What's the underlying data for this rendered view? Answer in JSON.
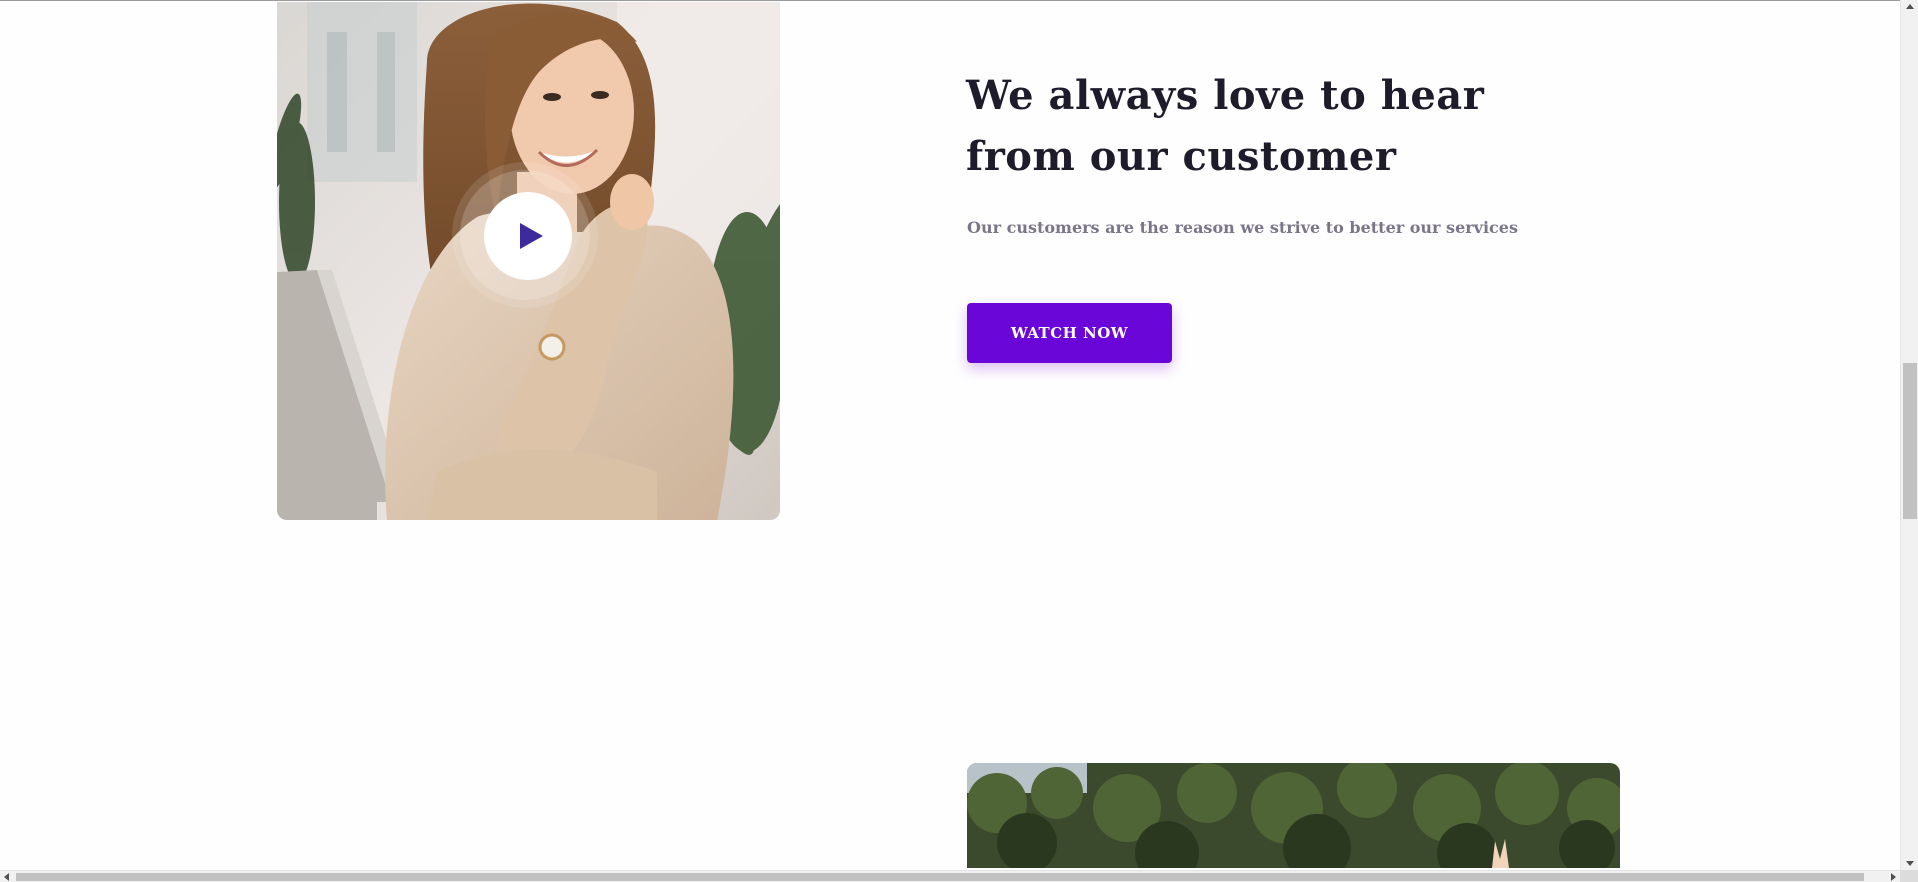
{
  "testimonial": {
    "headline": "We always love to hear from our customer",
    "subtext": "Our customers are the reason we strive to better our services",
    "cta_label": "WATCH NOW",
    "accent_color": "#6a06d8",
    "heading_color": "#1e1b2a"
  },
  "media": {
    "video_thumbnail_icon": "play-icon",
    "photo_1": "woman-smiling-at-laptop-photo",
    "photo_2": "trees-landscape-photo"
  },
  "scrollbars": {
    "vertical": "vertical-scrollbar",
    "horizontal": "horizontal-scrollbar"
  }
}
